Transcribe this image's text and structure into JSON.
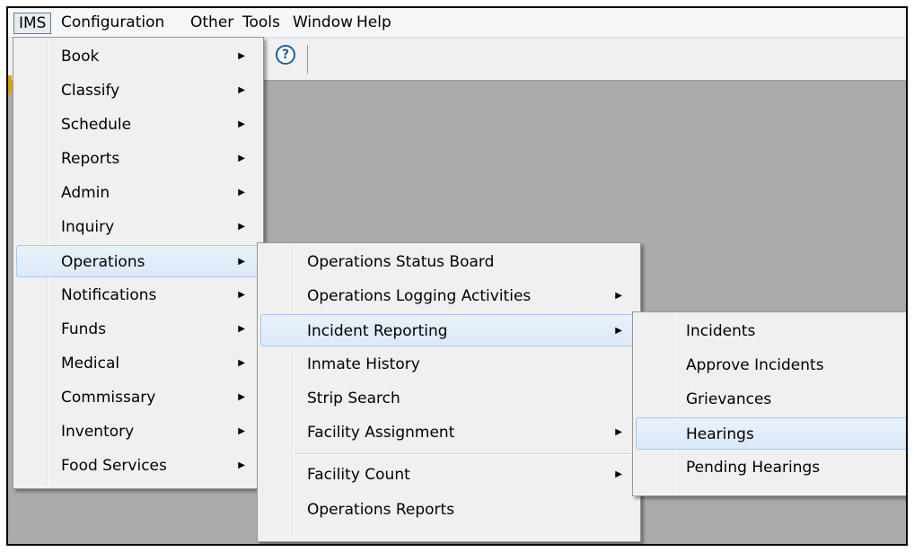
{
  "menubar": {
    "items": [
      {
        "label": "IMS"
      },
      {
        "label": "Configuration"
      },
      {
        "label": "Other"
      },
      {
        "label": "Tools"
      },
      {
        "label": "Window"
      },
      {
        "label": "Help"
      }
    ]
  },
  "toolbar": {
    "help_glyph": "?"
  },
  "ims_menu": {
    "items": [
      {
        "label": "Book"
      },
      {
        "label": "Classify"
      },
      {
        "label": "Schedule"
      },
      {
        "label": "Reports"
      },
      {
        "label": "Admin"
      },
      {
        "label": "Inquiry"
      },
      {
        "label": "Operations"
      },
      {
        "label": "Notifications"
      },
      {
        "label": "Funds"
      },
      {
        "label": "Medical"
      },
      {
        "label": "Commissary"
      },
      {
        "label": "Inventory"
      },
      {
        "label": "Food Services"
      }
    ],
    "highlighted": "Operations"
  },
  "operations_menu": {
    "items": [
      {
        "label": "Operations Status Board"
      },
      {
        "label": "Operations Logging Activities"
      },
      {
        "label": "Incident Reporting"
      },
      {
        "label": "Inmate History"
      },
      {
        "label": "Strip Search"
      },
      {
        "label": "Facility Assignment"
      },
      {
        "label": "Facility Count"
      },
      {
        "label": "Operations Reports"
      }
    ],
    "highlighted": "Incident Reporting"
  },
  "incident_menu": {
    "items": [
      {
        "label": "Incidents"
      },
      {
        "label": "Approve Incidents"
      },
      {
        "label": "Grievances"
      },
      {
        "label": "Hearings"
      },
      {
        "label": "Pending Hearings"
      }
    ],
    "highlighted": "Hearings"
  },
  "submenu_arrow": "▶"
}
